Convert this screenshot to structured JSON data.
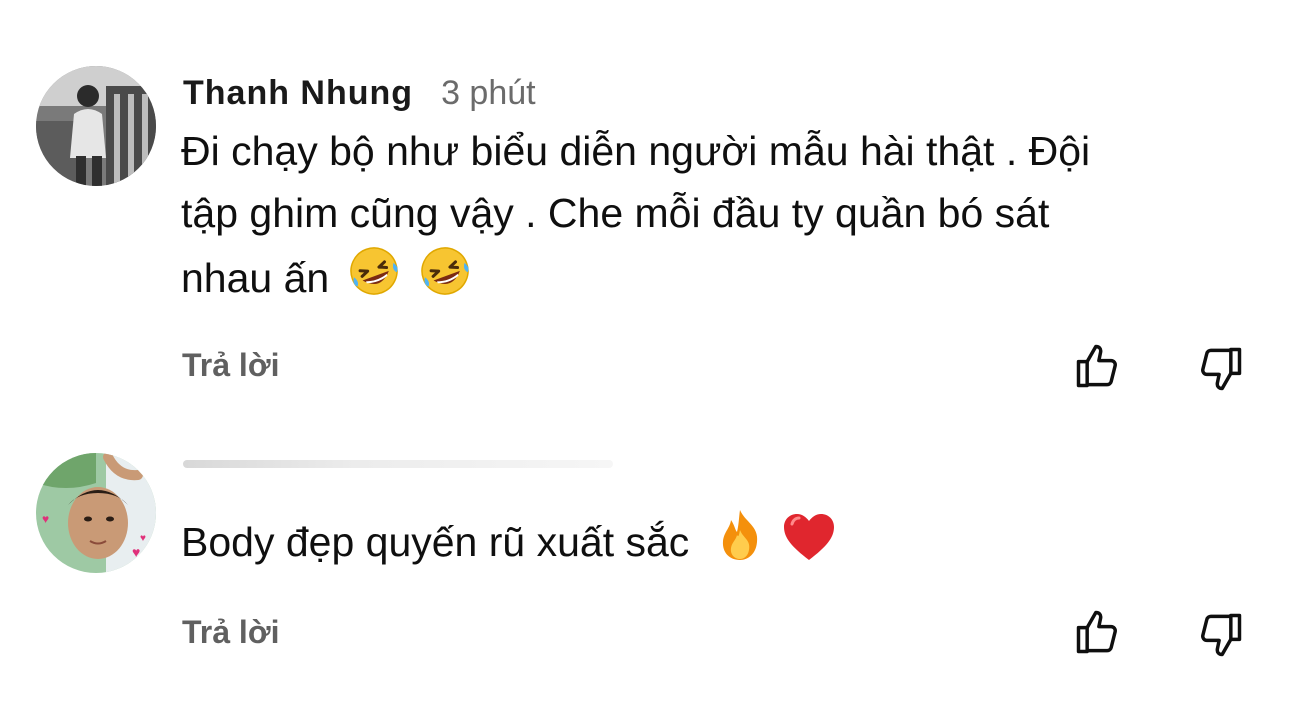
{
  "comments": [
    {
      "author": "Thanh Nhung",
      "time": "3 phút",
      "text_line1": "Đi chạy bộ như biểu diễn người mẫu hài thật . Đội",
      "text_line2": "tập ghim cũng vậy . Che mỗi đầu ty quần bó sát",
      "text_line3": "nhau ấn",
      "emojis": [
        "rolling-on-floor-laughing",
        "rolling-on-floor-laughing"
      ],
      "reply_label": "Trả lời",
      "like_icon": "thumb-up-icon",
      "dislike_icon": "thumb-down-icon"
    },
    {
      "author": "",
      "time": "",
      "text_line1": "Body đẹp quyến rũ xuất sắc",
      "emojis": [
        "fire",
        "red-heart"
      ],
      "reply_label": "Trả lời",
      "like_icon": "thumb-up-icon",
      "dislike_icon": "thumb-down-icon"
    }
  ],
  "colors": {
    "text_primary": "#0f0f0f",
    "text_secondary": "#606060",
    "icon_stroke": "#0f0f0f",
    "background": "#ffffff"
  }
}
